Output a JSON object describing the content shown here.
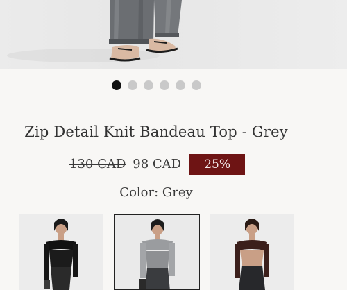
{
  "hero": {
    "image": "model-legs-grey-jeans-sandals"
  },
  "carousel": {
    "count": 6,
    "active_index": 0
  },
  "product": {
    "title": "Zip Detail Knit Bandeau Top - Grey",
    "original_price": "130 CAD",
    "sale_price": "98 CAD",
    "discount_badge": "25%",
    "color_label": "Color: Grey"
  },
  "swatches": [
    {
      "color": "black",
      "selected": false
    },
    {
      "color": "grey",
      "selected": true
    },
    {
      "color": "brown",
      "selected": false
    }
  ],
  "colors": {
    "badge_bg": "#6e1414",
    "active_dot": "#111111",
    "inactive_dot": "#c9c9c9"
  }
}
